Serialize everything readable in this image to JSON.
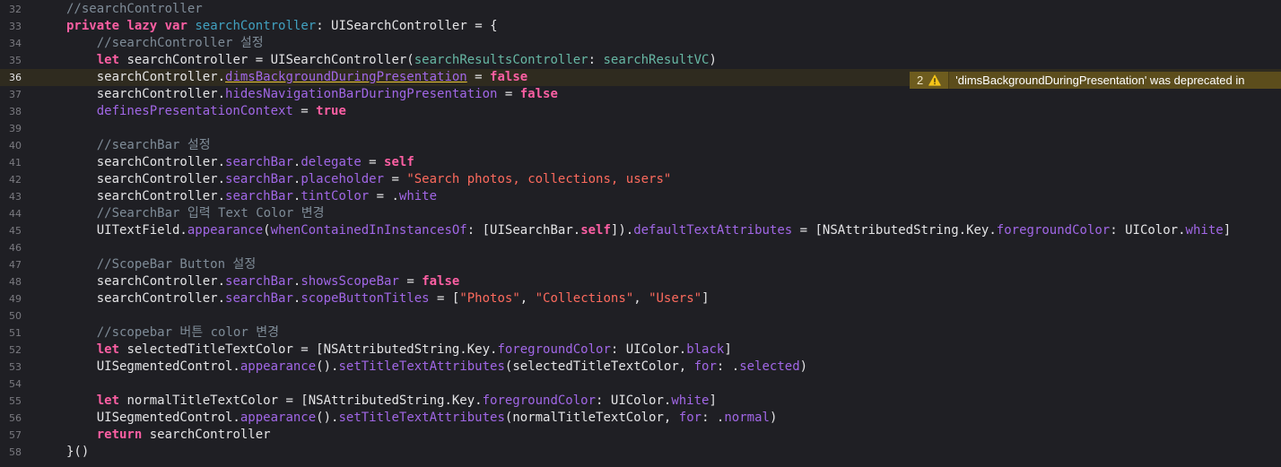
{
  "editor": {
    "current_line": 36,
    "lines": [
      {
        "num": "32",
        "tokens": [
          [
            "t-comment",
            "//searchController"
          ]
        ]
      },
      {
        "num": "33",
        "tokens": [
          [
            "t-kw",
            "private"
          ],
          [
            "t-plain",
            " "
          ],
          [
            "t-kw",
            "lazy"
          ],
          [
            "t-plain",
            " "
          ],
          [
            "t-kw",
            "var"
          ],
          [
            "t-plain",
            " "
          ],
          [
            "t-decl",
            "searchController"
          ],
          [
            "t-plain",
            ": UISearchController = {"
          ]
        ]
      },
      {
        "num": "34",
        "tokens": [
          [
            "t-plain",
            "    "
          ],
          [
            "t-comment",
            "//searchController 설정"
          ]
        ]
      },
      {
        "num": "35",
        "tokens": [
          [
            "t-plain",
            "    "
          ],
          [
            "t-kw",
            "let"
          ],
          [
            "t-plain",
            " searchController = UISearchController("
          ],
          [
            "t-param",
            "searchResultsController"
          ],
          [
            "t-plain",
            ": "
          ],
          [
            "t-param",
            "searchResultVC"
          ],
          [
            "t-plain",
            ")"
          ]
        ]
      },
      {
        "num": "36",
        "tokens": [
          [
            "t-plain",
            "    searchController."
          ],
          [
            "t-prop t-dep",
            "dimsBackgroundDuringPresentation"
          ],
          [
            "t-plain",
            " = "
          ],
          [
            "t-kw",
            "false"
          ]
        ]
      },
      {
        "num": "37",
        "tokens": [
          [
            "t-plain",
            "    searchController."
          ],
          [
            "t-prop",
            "hidesNavigationBarDuringPresentation"
          ],
          [
            "t-plain",
            " = "
          ],
          [
            "t-kw",
            "false"
          ]
        ]
      },
      {
        "num": "38",
        "tokens": [
          [
            "t-plain",
            "    "
          ],
          [
            "t-prop",
            "definesPresentationContext"
          ],
          [
            "t-plain",
            " = "
          ],
          [
            "t-kw",
            "true"
          ]
        ]
      },
      {
        "num": "39",
        "tokens": []
      },
      {
        "num": "40",
        "tokens": [
          [
            "t-plain",
            "    "
          ],
          [
            "t-comment",
            "//searchBar 설정"
          ]
        ]
      },
      {
        "num": "41",
        "tokens": [
          [
            "t-plain",
            "    searchController."
          ],
          [
            "t-prop",
            "searchBar"
          ],
          [
            "t-plain",
            "."
          ],
          [
            "t-prop",
            "delegate"
          ],
          [
            "t-plain",
            " = "
          ],
          [
            "t-kw",
            "self"
          ]
        ]
      },
      {
        "num": "42",
        "tokens": [
          [
            "t-plain",
            "    searchController."
          ],
          [
            "t-prop",
            "searchBar"
          ],
          [
            "t-plain",
            "."
          ],
          [
            "t-prop",
            "placeholder"
          ],
          [
            "t-plain",
            " = "
          ],
          [
            "t-str",
            "\"Search photos, collections, users\""
          ]
        ]
      },
      {
        "num": "43",
        "tokens": [
          [
            "t-plain",
            "    searchController."
          ],
          [
            "t-prop",
            "searchBar"
          ],
          [
            "t-plain",
            "."
          ],
          [
            "t-prop",
            "tintColor"
          ],
          [
            "t-plain",
            " = ."
          ],
          [
            "t-prop",
            "white"
          ]
        ]
      },
      {
        "num": "44",
        "tokens": [
          [
            "t-plain",
            "    "
          ],
          [
            "t-comment",
            "//SearchBar 입력 Text Color 변경"
          ]
        ]
      },
      {
        "num": "45",
        "tokens": [
          [
            "t-plain",
            "    UITextField."
          ],
          [
            "t-prop",
            "appearance"
          ],
          [
            "t-plain",
            "("
          ],
          [
            "t-prop",
            "whenContainedInInstancesOf"
          ],
          [
            "t-plain",
            ": [UISearchBar."
          ],
          [
            "t-kw",
            "self"
          ],
          [
            "t-plain",
            "])."
          ],
          [
            "t-prop",
            "defaultTextAttributes"
          ],
          [
            "t-plain",
            " = [NSAttributedString.Key."
          ],
          [
            "t-prop",
            "foregroundColor"
          ],
          [
            "t-plain",
            ": UIColor."
          ],
          [
            "t-prop",
            "white"
          ],
          [
            "t-plain",
            "]"
          ]
        ]
      },
      {
        "num": "46",
        "tokens": []
      },
      {
        "num": "47",
        "tokens": [
          [
            "t-plain",
            "    "
          ],
          [
            "t-comment",
            "//ScopeBar Button 설정"
          ]
        ]
      },
      {
        "num": "48",
        "tokens": [
          [
            "t-plain",
            "    searchController."
          ],
          [
            "t-prop",
            "searchBar"
          ],
          [
            "t-plain",
            "."
          ],
          [
            "t-prop",
            "showsScopeBar"
          ],
          [
            "t-plain",
            " = "
          ],
          [
            "t-kw",
            "false"
          ]
        ]
      },
      {
        "num": "49",
        "tokens": [
          [
            "t-plain",
            "    searchController."
          ],
          [
            "t-prop",
            "searchBar"
          ],
          [
            "t-plain",
            "."
          ],
          [
            "t-prop",
            "scopeButtonTitles"
          ],
          [
            "t-plain",
            " = ["
          ],
          [
            "t-str",
            "\"Photos\""
          ],
          [
            "t-plain",
            ", "
          ],
          [
            "t-str",
            "\"Collections\""
          ],
          [
            "t-plain",
            ", "
          ],
          [
            "t-str",
            "\"Users\""
          ],
          [
            "t-plain",
            "]"
          ]
        ]
      },
      {
        "num": "50",
        "tokens": []
      },
      {
        "num": "51",
        "tokens": [
          [
            "t-plain",
            "    "
          ],
          [
            "t-comment",
            "//scopebar 버튼 color 변경"
          ]
        ]
      },
      {
        "num": "52",
        "tokens": [
          [
            "t-plain",
            "    "
          ],
          [
            "t-kw",
            "let"
          ],
          [
            "t-plain",
            " selectedTitleTextColor = [NSAttributedString.Key."
          ],
          [
            "t-prop",
            "foregroundColor"
          ],
          [
            "t-plain",
            ": UIColor."
          ],
          [
            "t-prop",
            "black"
          ],
          [
            "t-plain",
            "]"
          ]
        ]
      },
      {
        "num": "53",
        "tokens": [
          [
            "t-plain",
            "    UISegmentedControl."
          ],
          [
            "t-prop",
            "appearance"
          ],
          [
            "t-plain",
            "()."
          ],
          [
            "t-prop",
            "setTitleTextAttributes"
          ],
          [
            "t-plain",
            "(selectedTitleTextColor, "
          ],
          [
            "t-prop",
            "for"
          ],
          [
            "t-plain",
            ": ."
          ],
          [
            "t-prop",
            "selected"
          ],
          [
            "t-plain",
            ")"
          ]
        ]
      },
      {
        "num": "54",
        "tokens": []
      },
      {
        "num": "55",
        "tokens": [
          [
            "t-plain",
            "    "
          ],
          [
            "t-kw",
            "let"
          ],
          [
            "t-plain",
            " normalTitleTextColor = [NSAttributedString.Key."
          ],
          [
            "t-prop",
            "foregroundColor"
          ],
          [
            "t-plain",
            ": UIColor."
          ],
          [
            "t-prop",
            "white"
          ],
          [
            "t-plain",
            "]"
          ]
        ]
      },
      {
        "num": "56",
        "tokens": [
          [
            "t-plain",
            "    UISegmentedControl."
          ],
          [
            "t-prop",
            "appearance"
          ],
          [
            "t-plain",
            "()."
          ],
          [
            "t-prop",
            "setTitleTextAttributes"
          ],
          [
            "t-plain",
            "(normalTitleTextColor, "
          ],
          [
            "t-prop",
            "for"
          ],
          [
            "t-plain",
            ": ."
          ],
          [
            "t-prop",
            "normal"
          ],
          [
            "t-plain",
            ")"
          ]
        ]
      },
      {
        "num": "57",
        "tokens": [
          [
            "t-plain",
            "    "
          ],
          [
            "t-kw",
            "return"
          ],
          [
            "t-plain",
            " searchController"
          ]
        ]
      },
      {
        "num": "58",
        "tokens": [
          [
            "t-plain",
            "}()"
          ]
        ]
      }
    ]
  },
  "warning": {
    "count": "2",
    "icon": "warning-triangle-icon",
    "message": "'dimsBackgroundDuringPresentation' was deprecated in"
  },
  "colors": {
    "background": "#1f1f24",
    "current_line": "#2f2b1f",
    "keyword": "#fc5fa3",
    "comment": "#7f8c98",
    "property": "#a167e6",
    "declaration": "#41a1c0",
    "string": "#fc6a5d",
    "parameter": "#67b7a4",
    "warning": "#5c4d1c"
  }
}
